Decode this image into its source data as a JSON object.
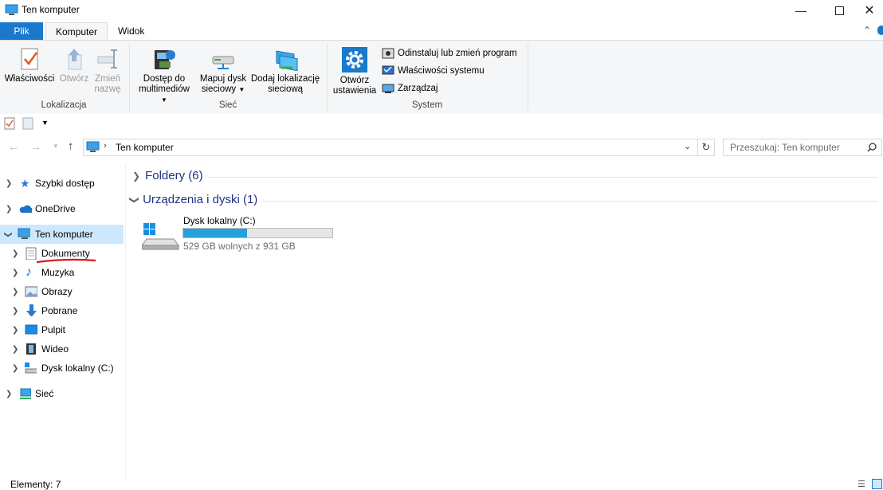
{
  "window": {
    "title": "Ten komputer"
  },
  "ribbon_tabs": [
    "Plik",
    "Komputer",
    "Widok"
  ],
  "ribbon": {
    "lokalizacja": {
      "label": "Lokalizacja",
      "properties": "Właściwości",
      "open": "Otwórz",
      "rename_line1": "Zmień",
      "rename_line2": "nazwę"
    },
    "siec": {
      "label": "Sieć",
      "media_line1": "Dostęp do",
      "media_line2": "multimediów",
      "map_line1": "Mapuj dysk",
      "map_line2": "sieciowy",
      "add_line1": "Dodaj lokalizację",
      "add_line2": "sieciową"
    },
    "system": {
      "label": "System",
      "settings_line1": "Otwórz",
      "settings_line2": "ustawienia",
      "uninstall": "Odinstaluj lub zmień program",
      "sys_props": "Właściwości systemu",
      "manage": "Zarządzaj"
    }
  },
  "address": {
    "path": "Ten komputer",
    "search_placeholder": "Przeszukaj: Ten komputer"
  },
  "nav": {
    "quick_access": "Szybki dostęp",
    "onedrive": "OneDrive",
    "this_pc": "Ten komputer",
    "children": [
      "Dokumenty",
      "Muzyka",
      "Obrazy",
      "Pobrane",
      "Pulpit",
      "Wideo",
      "Dysk lokalny (C:)"
    ],
    "network": "Sieć"
  },
  "main": {
    "folders_header": "Foldery (6)",
    "devices_header": "Urządzenia i dyski (1)",
    "drive": {
      "name": "Dysk lokalny (C:)",
      "free_text": "529 GB wolnych z 931 GB",
      "used_fraction": 0.43
    }
  },
  "status": {
    "items": "Elementy: 7"
  },
  "colors": {
    "accent": "#1979ca",
    "drive_bar": "#26a0da",
    "annotation": "#e0141e"
  }
}
